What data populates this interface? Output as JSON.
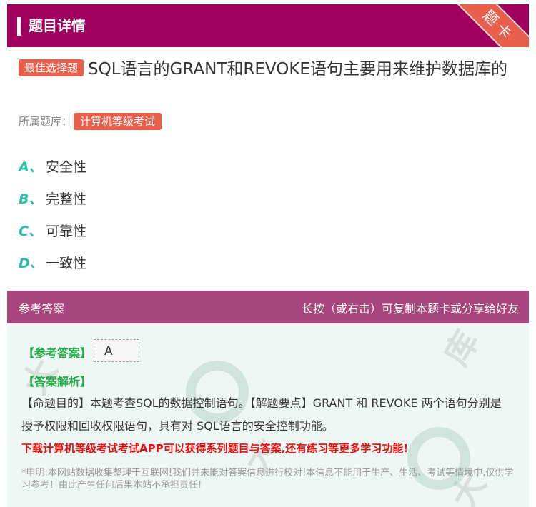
{
  "header": {
    "title": "题目详情",
    "corner_badge": "题卡",
    "accent_color": "#a0005d",
    "badge_color": "#e8604c"
  },
  "question": {
    "type_badge": "最佳选择题",
    "text": "SQL语言的GRANT和REVOKE语句主要用来维护数据库的",
    "source_label": "所属题库：",
    "source_tag": "计算机等级考试"
  },
  "options": [
    {
      "letter": "A、",
      "text": "安全性"
    },
    {
      "letter": "B、",
      "text": "完整性"
    },
    {
      "letter": "C、",
      "text": "可靠性"
    },
    {
      "letter": "D、",
      "text": "一致性"
    }
  ],
  "answer_section": {
    "title": "参考答案",
    "hint": "长按（或右击）可复制本题卡或分享给好友",
    "ref_answer_label": "【参考答案】",
    "ref_answer_value": "A",
    "analysis_label": "【答案解析】",
    "analysis_text": "【命题目的】本题考查SQL的数据控制语句。【解题要点】GRANT 和 REVOKE 两个语句分别是授予权限和回收权限语句，具有对 SQL语言的安全控制功能。",
    "promo_text": "下载计算机等级考试考试APP可以获得系列题目与答案,还有练习等更多学习功能!",
    "disclaimer": "*申明:本网站数据收集整理于互联网!我们并未能对答案信息进行校对!本信息不能用于生产、生活、考试等情境中,仅供学习参考！由此产生任何后果本站不承担责任!",
    "label_color": "#22aa44",
    "promo_color": "#e01010"
  }
}
